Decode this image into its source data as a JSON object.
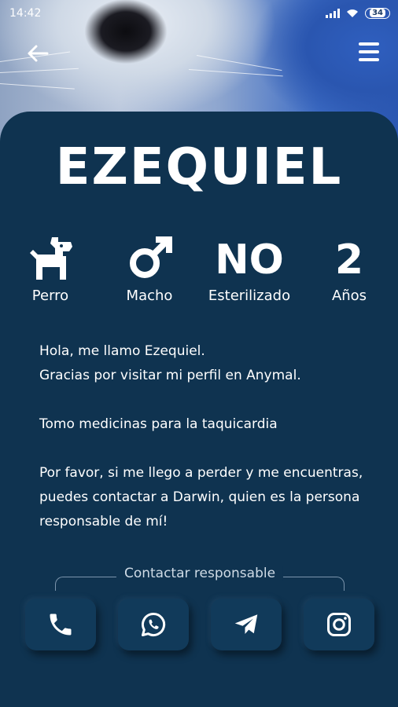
{
  "status_bar": {
    "time": "14:42",
    "battery": "34",
    "icons": [
      "signal-icon",
      "wifi-icon",
      "battery-icon"
    ]
  },
  "header": {
    "back_icon": "arrow-left-icon",
    "menu_icon": "hamburger-menu-icon"
  },
  "pet": {
    "name": "EZEQUIEL"
  },
  "stats": {
    "species": {
      "icon": "dog-icon",
      "label": "Perro"
    },
    "sex": {
      "icon": "male-symbol-icon",
      "label": "Macho"
    },
    "sterilized": {
      "value": "NO",
      "label": "Esterilizado"
    },
    "age": {
      "value": "2",
      "label": "Años"
    }
  },
  "bio": {
    "paragraph_1_line_1": "Hola, me llamo Ezequiel.",
    "paragraph_1_line_2": "Gracias por visitar mi perfil en Anymal.",
    "paragraph_2": "Tomo medicinas para la taquicardia",
    "paragraph_3": "Por favor, si me llego a perder y me encuentras, puedes contactar a Darwin, quien es la persona responsable de mí!"
  },
  "contact": {
    "title": "Contactar responsable",
    "buttons": [
      "phone-icon",
      "whatsapp-icon",
      "telegram-icon",
      "instagram-icon"
    ]
  },
  "colors": {
    "background": "#0f3350",
    "button": "#113a5a",
    "text": "#ffffff"
  }
}
